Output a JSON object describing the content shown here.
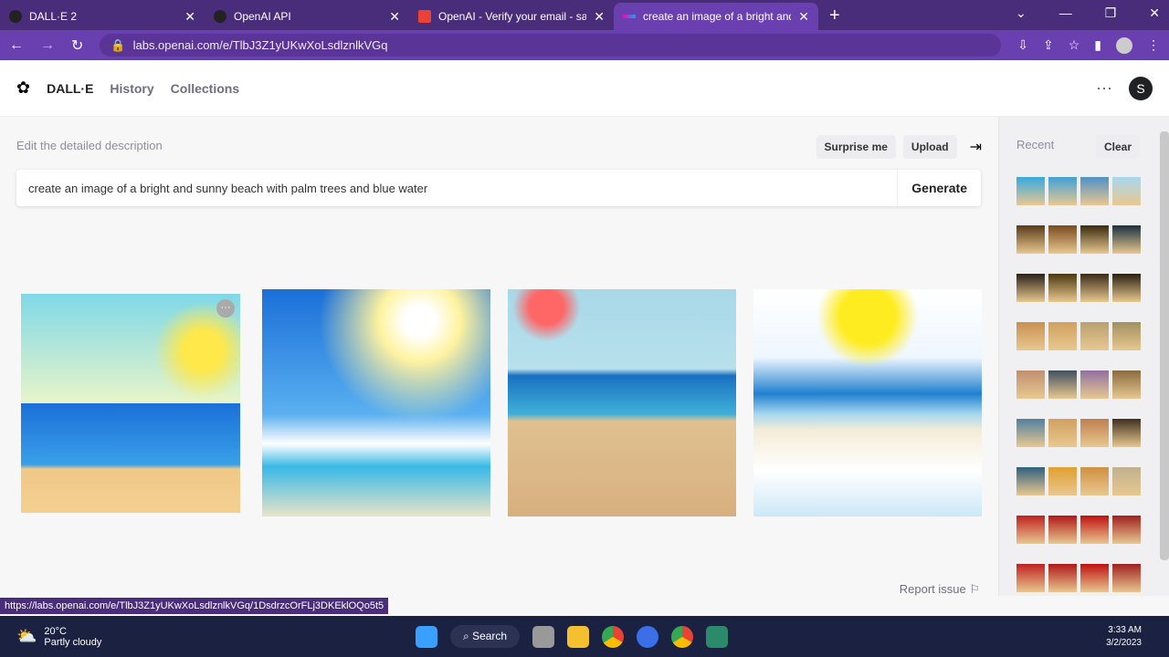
{
  "browser": {
    "tabs": [
      {
        "title": "DALL·E 2"
      },
      {
        "title": "OpenAI API"
      },
      {
        "title": "OpenAI - Verify your email - sam"
      },
      {
        "title": "create an image of a bright and sunny"
      }
    ],
    "url": "labs.openai.com/e/TlbJ3Z1yUKwXoLsdlznlkVGq",
    "status_url": "https://labs.openai.com/e/TlbJ3Z1yUKwXoLsdlznlkVGq/1DsdrzcOrFLj3DKEklOQo5t5"
  },
  "app": {
    "brand": "DALL·E",
    "nav": [
      "History",
      "Collections"
    ],
    "user_initial": "S"
  },
  "editor": {
    "label": "Edit the detailed description",
    "surprise": "Surprise me",
    "upload": "Upload",
    "prompt": "create an image of a bright and sunny beach with palm trees and blue water",
    "generate": "Generate",
    "report": "Report issue"
  },
  "sidebar": {
    "title": "Recent",
    "clear": "Clear"
  },
  "taskbar": {
    "temp": "20°C",
    "weather": "Partly cloudy",
    "search": "Search",
    "time": "3:33 AM",
    "date": "3/2/2023"
  },
  "colors": {
    "accent": "#6a3fb0",
    "tabbar": "#4a2d7a"
  }
}
